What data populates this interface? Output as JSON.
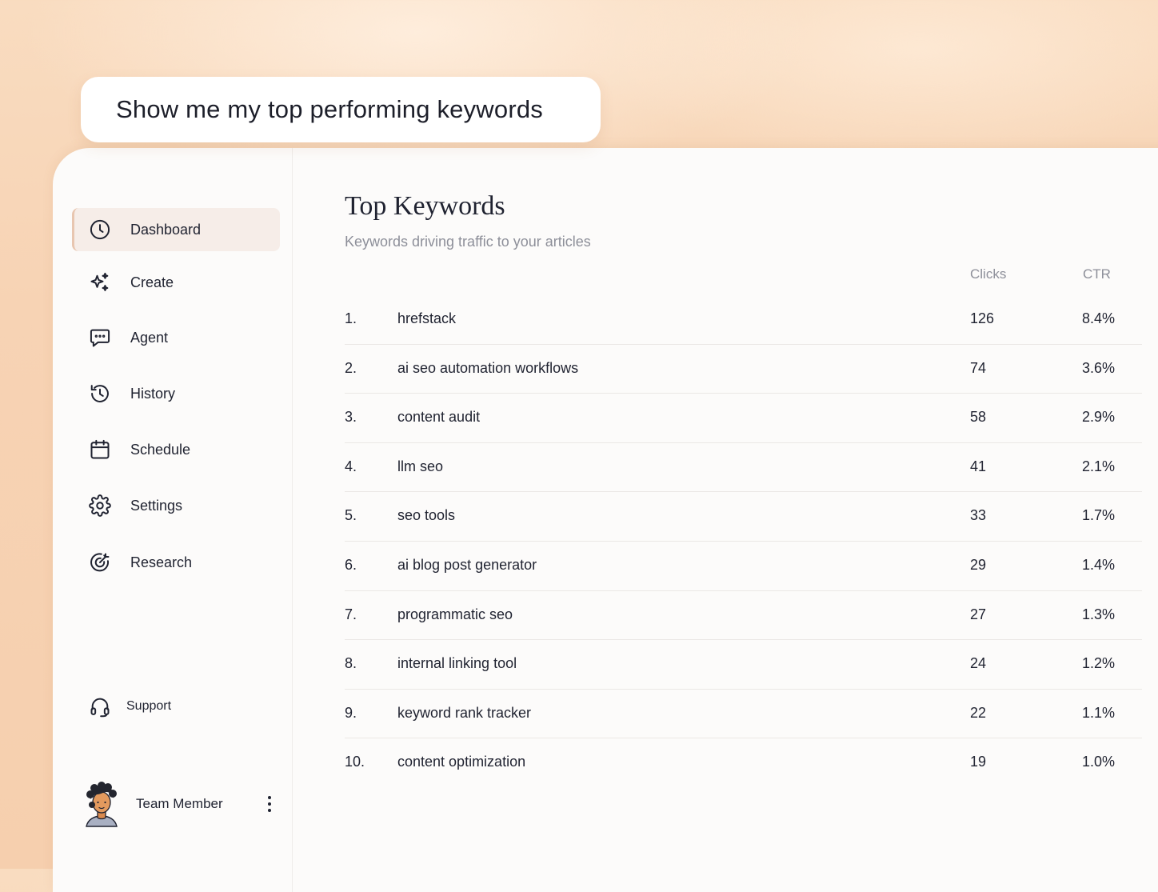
{
  "prompt": {
    "text": "Show me my top performing keywords"
  },
  "sidebar": {
    "items": [
      {
        "label": "Dashboard",
        "icon": "clock-icon",
        "active": true
      },
      {
        "label": "Create",
        "icon": "sparkles-icon",
        "active": false
      },
      {
        "label": "Agent",
        "icon": "chat-bubble-icon",
        "active": false
      },
      {
        "label": "History",
        "icon": "history-icon",
        "active": false
      },
      {
        "label": "Schedule",
        "icon": "calendar-icon",
        "active": false
      },
      {
        "label": "Settings",
        "icon": "gear-icon",
        "active": false
      },
      {
        "label": "Research",
        "icon": "target-icon",
        "active": false
      }
    ],
    "support_label": "Support",
    "support_icon": "headset-icon",
    "user": {
      "name": "Team Member",
      "avatar_icon": "avatar-illustration",
      "menu_icon": "kebab-menu-icon"
    }
  },
  "main": {
    "title": "Top Keywords",
    "subtitle": "Keywords driving traffic to your articles",
    "table": {
      "columns": {
        "clicks": "Clicks",
        "ctr": "CTR"
      },
      "rows": [
        {
          "rank": "1.",
          "keyword": "hrefstack",
          "clicks": "126",
          "ctr": "8.4%"
        },
        {
          "rank": "2.",
          "keyword": "ai seo automation workflows",
          "clicks": "74",
          "ctr": "3.6%"
        },
        {
          "rank": "3.",
          "keyword": "content audit",
          "clicks": "58",
          "ctr": "2.9%"
        },
        {
          "rank": "4.",
          "keyword": "llm seo",
          "clicks": "41",
          "ctr": "2.1%"
        },
        {
          "rank": "5.",
          "keyword": "seo tools",
          "clicks": "33",
          "ctr": "1.7%"
        },
        {
          "rank": "6.",
          "keyword": "ai blog post generator",
          "clicks": "29",
          "ctr": "1.4%"
        },
        {
          "rank": "7.",
          "keyword": "programmatic seo",
          "clicks": "27",
          "ctr": "1.3%"
        },
        {
          "rank": "8.",
          "keyword": "internal linking tool",
          "clicks": "24",
          "ctr": "1.2%"
        },
        {
          "rank": "9.",
          "keyword": "keyword rank tracker",
          "clicks": "22",
          "ctr": "1.1%"
        },
        {
          "rank": "10.",
          "keyword": "content optimization",
          "clicks": "19",
          "ctr": "1.0%"
        }
      ]
    }
  },
  "colors": {
    "background": "#f7d3b4",
    "panel": "#fcfbfa",
    "active_item": "#f6ede8",
    "text": "#1f2230",
    "muted_text": "#8d8f99"
  }
}
